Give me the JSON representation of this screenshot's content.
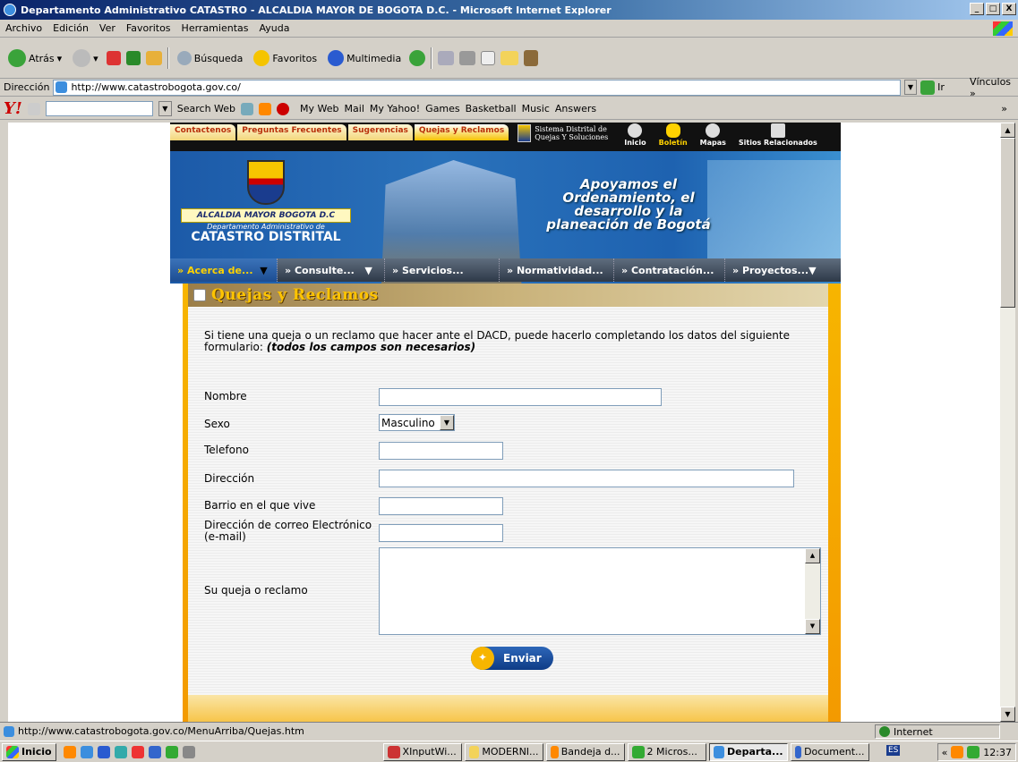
{
  "window": {
    "title": "Departamento Administrativo CATASTRO - ALCALDIA MAYOR DE BOGOTA D.C. - Microsoft Internet Explorer",
    "btn_min": "_",
    "btn_max": "□",
    "btn_close": "X"
  },
  "menu": [
    "Archivo",
    "Edición",
    "Ver",
    "Favoritos",
    "Herramientas",
    "Ayuda"
  ],
  "toolbar": {
    "back": "Atrás",
    "search": "Búsqueda",
    "favorites": "Favoritos",
    "media": "Multimedia"
  },
  "address": {
    "label": "Dirección",
    "url": "http://www.catastrobogota.gov.co/",
    "go": "Ir",
    "links": "Vínculos »"
  },
  "yahoo": {
    "logo": "Y!",
    "search_btn": "Search Web",
    "items": [
      "My Web",
      "Mail",
      "My Yahoo!",
      "Games",
      "Basketball",
      "Music",
      "Answers"
    ],
    "more": "»"
  },
  "site": {
    "tabs": [
      "Contactenos",
      "Preguntas Frecuentes",
      "Sugerencias",
      "Quejas y Reclamos"
    ],
    "sdq_line1": "Sistema Distrital de",
    "sdq_line2": "Quejas Y Soluciones",
    "top_icons": [
      "Inicio",
      "Boletín",
      "Mapas",
      "Sitios Relacionados"
    ],
    "alcaldia": "ALCALDIA MAYOR BOGOTA D.C",
    "dept": "Departamento Administrativo de",
    "catastro": "CATASTRO DISTRITAL",
    "slogan": "Apoyamos el Ordenamiento, el desarrollo y la planeación de Bogotá",
    "nav": [
      "Acerca de...",
      "Consulte...",
      "Servicios...",
      "Normatividad...",
      "Contratación...",
      "Proyectos..."
    ],
    "nav_prefix": "»",
    "nav_arrow": "▼"
  },
  "form": {
    "section_title": "Quejas y Reclamos",
    "intro": "Si tiene una queja o un reclamo que hacer ante el DACD, puede hacerlo completando los datos del siguiente formulario: ",
    "intro_bold": "(todos los campos son necesarios)",
    "labels": {
      "nombre": "Nombre",
      "sexo": "Sexo",
      "telefono": "Telefono",
      "direccion": "Dirección",
      "barrio": "Barrio en el que vive",
      "correo": "Dirección de correo Electrónico (e-mail)",
      "queja": "Su queja o reclamo"
    },
    "sexo_value": "Masculino",
    "submit": "Enviar"
  },
  "status": {
    "url": "http://www.catastrobogota.gov.co/MenuArriba/Quejas.htm",
    "zone": "Internet"
  },
  "taskbar": {
    "start": "Inicio",
    "tasks": [
      "XInputWi...",
      "MODERNI...",
      "Bandeja d...",
      "2 Micros...",
      "Departa...",
      "Document..."
    ],
    "lang": "ES",
    "clock": "12:37"
  }
}
